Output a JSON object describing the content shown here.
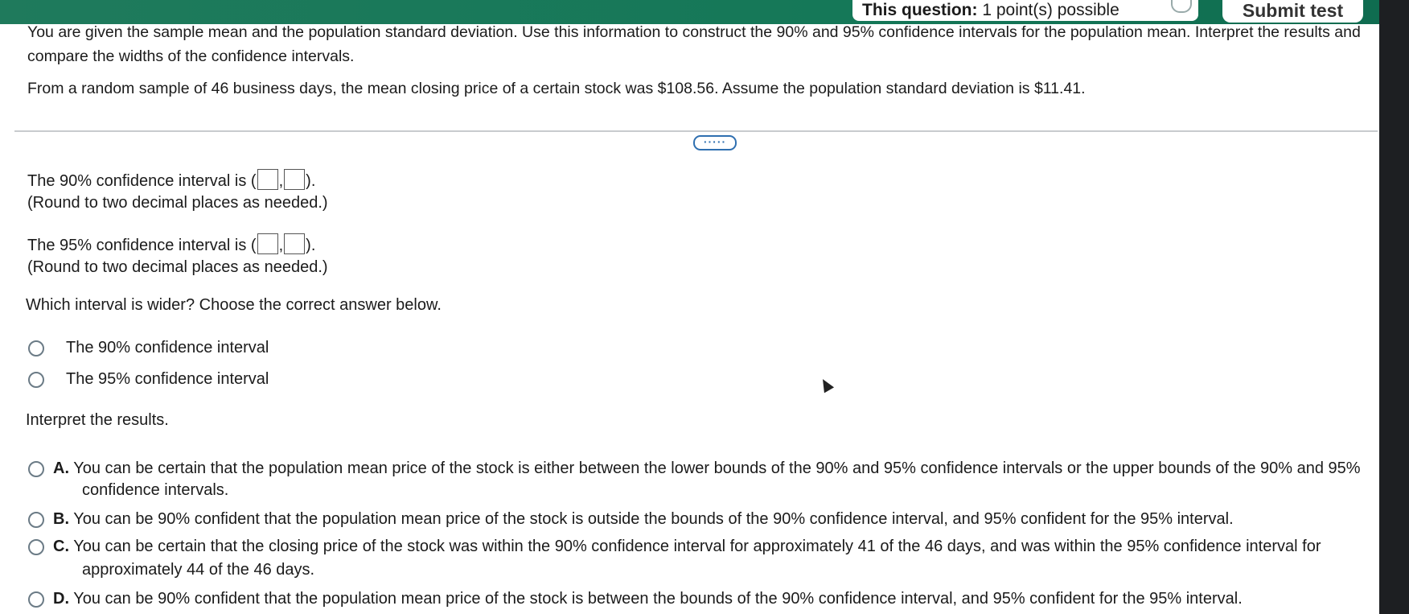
{
  "header": {
    "points_label": "This question:",
    "points_value": "1 point(s) possible",
    "submit_label": "Submit test"
  },
  "question": {
    "intro_line1": "You are given the sample mean and the population standard deviation. Use this information to construct the 90% and 95% confidence intervals for the population mean. Interpret the results and",
    "intro_line2": "compare the widths of the confidence intervals.",
    "data_line": "From a random sample of 46 business days, the mean closing price of a certain stock was $108.56. Assume the population standard deviation is $11.41.",
    "more_label": "·····"
  },
  "parts": {
    "ci90_prefix": "The 90% confidence interval is (",
    "ci90_mid": ",",
    "ci90_suffix": ").",
    "ci90_note": "(Round to two decimal places as needed.)",
    "ci95_prefix": "The 95% confidence interval is (",
    "ci95_mid": ",",
    "ci95_suffix": ").",
    "ci95_note": "(Round to two decimal places as needed.)",
    "wider_prompt": "Which interval is wider? Choose the correct answer below.",
    "wider_options": [
      "The 90% confidence interval",
      "The 95% confidence interval"
    ],
    "interpret_prompt": "Interpret the results."
  },
  "interpret_options": [
    {
      "letter": "A.",
      "line1": "You can be certain that the population mean price of the stock is either between the lower bounds of the 90% and 95% confidence intervals or the upper bounds of the 90% and 95%",
      "line2": "confidence intervals."
    },
    {
      "letter": "B.",
      "line1": "You can be 90% confident that the population mean price of the stock is outside the bounds of the 90% confidence interval, and 95% confident for the 95% interval.",
      "line2": ""
    },
    {
      "letter": "C.",
      "line1": "You can be certain that the closing price of the stock was within the 90% confidence interval for approximately 41 of the 46 days, and was within the 95% confidence interval for",
      "line2": "approximately 44 of the 46 days."
    },
    {
      "letter": "D.",
      "line1": "You can be 90% confident that the population mean price of the stock is between the bounds of the 90% confidence interval, and 95% confident for the 95% interval.",
      "line2": ""
    }
  ]
}
